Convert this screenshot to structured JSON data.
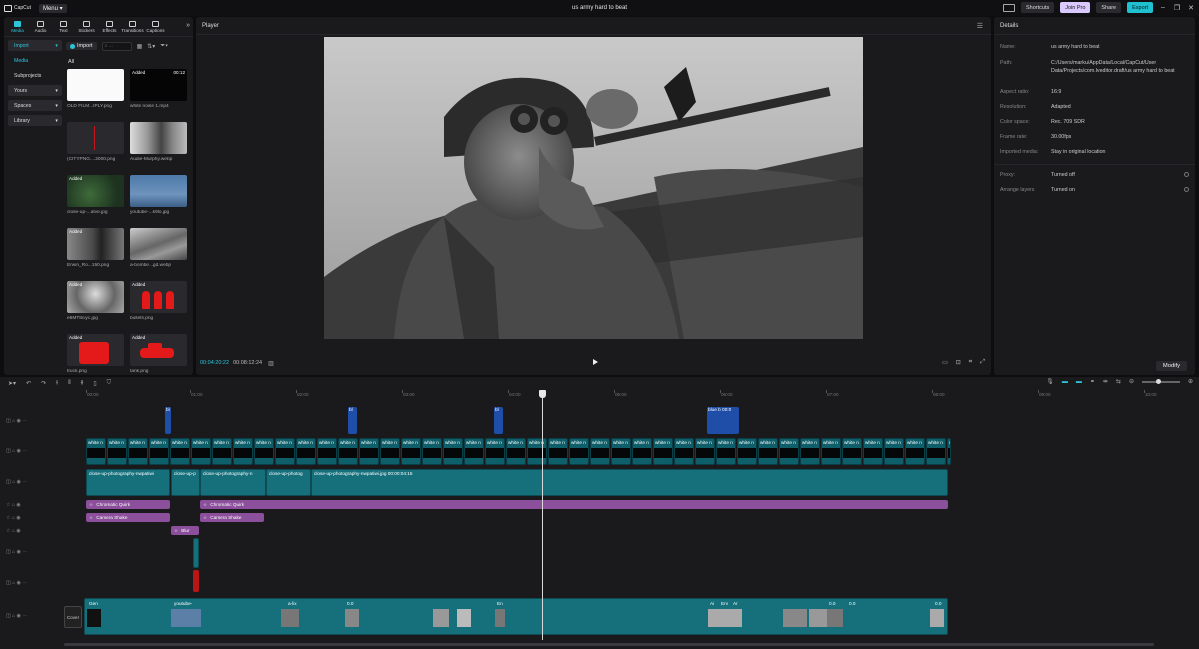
{
  "titlebar": {
    "app_name": "CapCut",
    "menu_label": "Menu",
    "title": "us army hard to beat",
    "shortcuts_label": "Shortcuts",
    "join_pro_label": "Join Pro",
    "share_label": "Share",
    "export_label": "Export"
  },
  "tool_tabs": [
    {
      "label": "Media",
      "icon": "media-icon"
    },
    {
      "label": "Audio",
      "icon": "audio-icon"
    },
    {
      "label": "Text",
      "icon": "text-icon"
    },
    {
      "label": "Stickers",
      "icon": "stickers-icon"
    },
    {
      "label": "Effects",
      "icon": "effects-icon"
    },
    {
      "label": "Transitions",
      "icon": "transitions-icon"
    },
    {
      "label": "Captions",
      "icon": "captions-icon"
    }
  ],
  "media": {
    "side": [
      "Import",
      "Media",
      "Subprojects",
      "Yours",
      "Spaces",
      "Library"
    ],
    "import_label": "Import",
    "all_label": "All",
    "items": [
      {
        "name": "OLD FILM...IPLY.png",
        "added": "",
        "dur": ""
      },
      {
        "name": "white noise 1.mp4",
        "added": "Added",
        "dur": "00:12"
      },
      {
        "name": "(CITYPNG....2000.png",
        "added": "",
        "dur": ""
      },
      {
        "name": "Audie-Murphy.webp",
        "added": "",
        "dur": ""
      },
      {
        "name": "close-up-...atve.jpg",
        "added": "Added",
        "dur": ""
      },
      {
        "name": "youtube-...k9lo.jpg",
        "added": "",
        "dur": ""
      },
      {
        "name": "Erwin_Ro...150.png",
        "added": "Added",
        "dur": ""
      },
      {
        "name": "a-bombe...gd.webp",
        "added": "",
        "dur": ""
      },
      {
        "name": "e6MT8ciyc.jpg",
        "added": "Added",
        "dur": ""
      },
      {
        "name": "bullets.png",
        "added": "Added",
        "dur": ""
      },
      {
        "name": "truck.png",
        "added": "Added",
        "dur": ""
      },
      {
        "name": "tank.png",
        "added": "Added",
        "dur": ""
      }
    ]
  },
  "player": {
    "title": "Player",
    "current_time": "00:04:20:22",
    "total_time": "00:08:12:24"
  },
  "details": {
    "title": "Details",
    "rows": [
      {
        "label": "Name:",
        "value": "us army hard to beat"
      },
      {
        "label": "Path:",
        "value": "C:/Users/marku/AppData/Local/CapCut/User Data/Projects/com.lveditor.draft/us army hard to beat"
      },
      {
        "label": "Aspect ratio:",
        "value": "16:9"
      },
      {
        "label": "Resolution:",
        "value": "Adapted"
      },
      {
        "label": "Color space:",
        "value": "Rec. 709 SDR"
      },
      {
        "label": "Frame rate:",
        "value": "30.00fps"
      },
      {
        "label": "Imported media:",
        "value": "Stay in original location"
      }
    ],
    "rows2": [
      {
        "label": "Proxy:",
        "value": "Turned off"
      },
      {
        "label": "Arrange layers",
        "value": "Turned on"
      }
    ],
    "modify_label": "Modify"
  },
  "timeline": {
    "ruler": [
      "00:00",
      "01:00",
      "02:00",
      "03:00",
      "04:00",
      "05:00",
      "06:00",
      "07:00",
      "08:00",
      "09:00",
      "10:00"
    ],
    "cover_label": "Cover",
    "text_blue": [
      "bl",
      "bl",
      "bl",
      "blue b"
    ],
    "text_blue_dur": "00:0",
    "white_label": "white n",
    "closeup": [
      "close-up-photography-nwpatiwi",
      "close-up-p",
      "close-up-photography-n",
      "close-up-photog",
      "close-up-photography-nwpatiwi.jpg  00:00:04:15"
    ],
    "fx": [
      "Chromatic Quirk",
      "Camera Shake",
      "Chromatic Quirk",
      "Camera Shake",
      "Blur"
    ],
    "main_labels": [
      "Gen",
      "youtube-",
      "a-lix",
      "0.0",
      "En",
      "Ai",
      "Erv",
      "Ar",
      "0.0",
      "0.0",
      "0.0"
    ]
  }
}
